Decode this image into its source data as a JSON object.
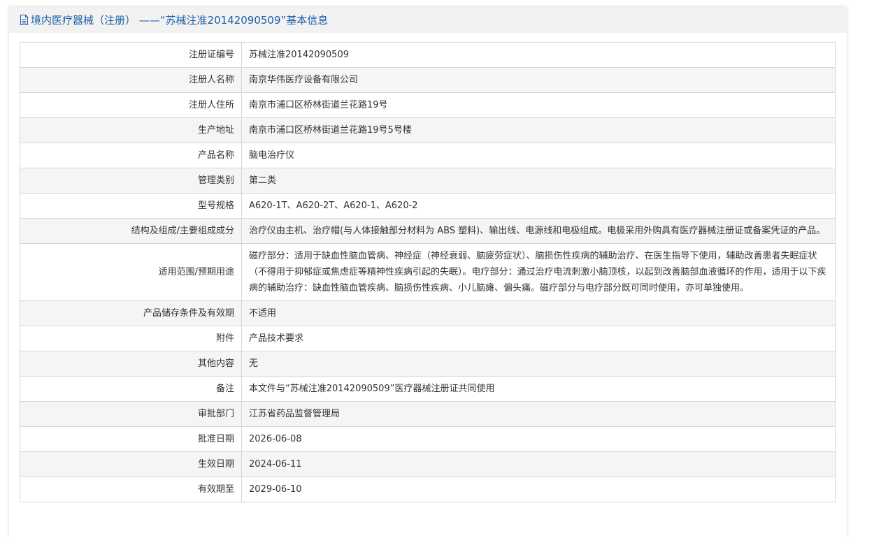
{
  "header": {
    "icon": "document-icon",
    "title": "境内医疗器械（注册） ——“苏械注准20142090509”基本信息"
  },
  "rows": [
    {
      "label": "注册证编号",
      "value": "苏械注准20142090509"
    },
    {
      "label": "注册人名称",
      "value": "南京华伟医疗设备有限公司"
    },
    {
      "label": "注册人住所",
      "value": "南京市浦口区桥林街道兰花路19号"
    },
    {
      "label": "生产地址",
      "value": "南京市浦口区桥林街道兰花路19号5号楼"
    },
    {
      "label": "产品名称",
      "value": "脑电治疗仪"
    },
    {
      "label": "管理类别",
      "value": "第二类"
    },
    {
      "label": "型号规格",
      "value": "A620-1T、A620-2T、A620-1、A620-2"
    },
    {
      "label": "结构及组成/主要组成成分",
      "value": "治疗仪由主机、治疗帽(与人体接触部分材料为 ABS 塑料)、输出线、电源线和电极组成。电极采用外购具有医疗器械注册证或备案凭证的产品。"
    },
    {
      "label": "适用范围/预期用途",
      "value": "磁疗部分：适用于缺血性脑血管病、神经症（神经衰弱、脑疲劳症状）、脑损伤性疾病的辅助治疗、在医生指导下使用，辅助改善患者失眠症状（不得用于抑郁症或焦虑症等精神性疾病引起的失眠）。电疗部分：通过治疗电流刺激小脑顶核，以起到改善脑部血液循环的作用，适用于以下疾病的辅助治疗：缺血性脑血管疾病、脑损伤性疾病、小儿脑瘫、偏头痛。磁疗部分与电疗部分既可同时使用，亦可单独使用。"
    },
    {
      "label": "产品储存条件及有效期",
      "value": "不适用"
    },
    {
      "label": "附件",
      "value": "产品技术要求"
    },
    {
      "label": "其他内容",
      "value": "无"
    },
    {
      "label": "备注",
      "value": "本文件与“苏械注准20142090509”医疗器械注册证共同使用"
    },
    {
      "label": "审批部门",
      "value": "江苏省药品监督管理局"
    },
    {
      "label": "批准日期",
      "value": "2026-06-08"
    },
    {
      "label": "生效日期",
      "value": "2024-06-11"
    },
    {
      "label": "有效期至",
      "value": "2029-06-10"
    }
  ]
}
